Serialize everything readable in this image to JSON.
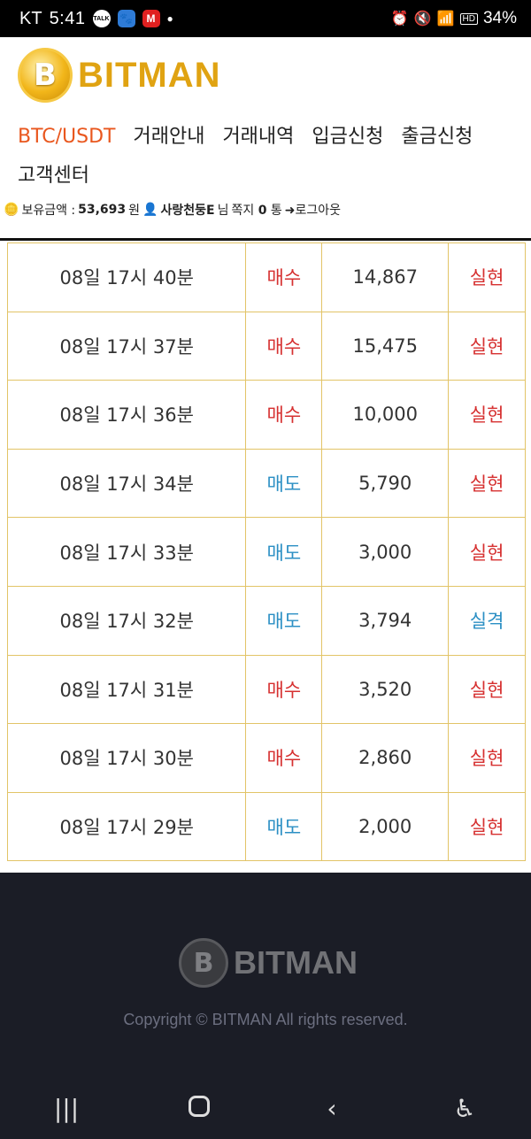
{
  "statusbar": {
    "carrier": "KT",
    "time": "5:41",
    "battery": "34%",
    "hd_badge": "HD",
    "apps": [
      "TALK",
      "🐾",
      "M"
    ]
  },
  "header": {
    "logo_text": "BITMAN",
    "logo_glyph": "B",
    "nav": [
      {
        "label": "BTC/USDT",
        "active": true
      },
      {
        "label": "거래안내",
        "active": false
      },
      {
        "label": "거래내역",
        "active": false
      },
      {
        "label": "입금신청",
        "active": false
      },
      {
        "label": "출금신청",
        "active": false
      },
      {
        "label": "고객센터",
        "active": false
      }
    ],
    "userbar": {
      "balance_label": "보유금액 :",
      "balance_value": "53,693",
      "balance_unit": "원",
      "username": "사랑천둥E",
      "honorific": "님",
      "message_label": "쪽지",
      "message_count": "0",
      "message_unit": "통",
      "logout_label": "로그아웃"
    }
  },
  "trades": {
    "rows": [
      {
        "time": "08일 17시 40분",
        "type": "매수",
        "amount": "14,867",
        "result": "실현"
      },
      {
        "time": "08일 17시 37분",
        "type": "매수",
        "amount": "15,475",
        "result": "실현"
      },
      {
        "time": "08일 17시 36분",
        "type": "매수",
        "amount": "10,000",
        "result": "실현"
      },
      {
        "time": "08일 17시 34분",
        "type": "매도",
        "amount": "5,790",
        "result": "실현"
      },
      {
        "time": "08일 17시 33분",
        "type": "매도",
        "amount": "3,000",
        "result": "실현"
      },
      {
        "time": "08일 17시 32분",
        "type": "매도",
        "amount": "3,794",
        "result": "실격"
      },
      {
        "time": "08일 17시 31분",
        "type": "매수",
        "amount": "3,520",
        "result": "실현"
      },
      {
        "time": "08일 17시 30분",
        "type": "매수",
        "amount": "2,860",
        "result": "실현"
      },
      {
        "time": "08일 17시 29분",
        "type": "매도",
        "amount": "2,000",
        "result": "실현"
      }
    ],
    "colors": {
      "buy": "#d63030",
      "sell": "#2b8fc4",
      "win": "#d63030",
      "lose": "#2b8fc4"
    }
  },
  "footer": {
    "logo_text": "BITMAN",
    "copyright": "Copyright © BITMAN All rights reserved."
  },
  "navbar": {
    "recent": "|||",
    "back": "‹",
    "accessibility": "♿"
  }
}
